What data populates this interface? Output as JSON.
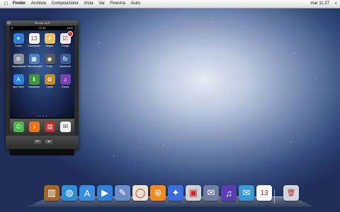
{
  "menubar": {
    "apple": "",
    "menus": [
      "Finder",
      "Archivio",
      "Composizione",
      "Vista",
      "Vai",
      "Finestra",
      "Aiuto"
    ],
    "clock": "mar 11.37"
  },
  "window": {
    "title": "iPhone 3GS",
    "status": {
      "carrier": "E",
      "time": "23.35",
      "battery": "61%"
    },
    "apps": [
      {
        "label": "Safari",
        "color": "#2c7fd6",
        "glyph": "✦"
      },
      {
        "label": "Calendario",
        "color": "#ffffff",
        "glyph": "13"
      },
      {
        "label": "Mappe",
        "color": "#e8c468",
        "glyph": "⌖"
      },
      {
        "label": "Things",
        "color": "#e9e9e9",
        "glyph": "☑",
        "badge": "3"
      },
      {
        "label": "Impostazioni",
        "color": "#8a8f99",
        "glyph": "⚙"
      },
      {
        "label": "WinterBoard",
        "color": "#4e7fc0",
        "glyph": "▦"
      },
      {
        "label": "Foto",
        "color": "#5a5a5a",
        "glyph": "◉"
      },
      {
        "label": "Facebook",
        "color": "#3b5b9a",
        "glyph": "fb"
      },
      {
        "label": "App Store",
        "color": "#2a7fe0",
        "glyph": "A"
      },
      {
        "label": "Installous",
        "color": "#3a9a3a",
        "glyph": "⬇"
      },
      {
        "label": "Cydia",
        "color": "#c98a2a",
        "glyph": "✿"
      },
      {
        "label": "iTunes",
        "color": "#7a3fb0",
        "glyph": "♫"
      }
    ],
    "page_dots": "• • • •",
    "dock_apps": [
      {
        "name": "phone",
        "color": "#4cb848",
        "glyph": "✆"
      },
      {
        "name": "music",
        "color": "#e8731c",
        "glyph": "♪"
      },
      {
        "name": "store",
        "color": "#b83232",
        "glyph": "▤"
      },
      {
        "name": "notes",
        "color": "#eeeeee",
        "glyph": "✉"
      }
    ],
    "buttons": [
      "↶",
      "▾"
    ]
  },
  "dock": [
    {
      "name": "bookshelf",
      "color": "#a0652a",
      "glyph": "▥"
    },
    {
      "name": "globe",
      "color": "#2f8fd6",
      "glyph": "◍"
    },
    {
      "name": "app-store",
      "color": "#3a8ee0",
      "glyph": "A"
    },
    {
      "name": "facetime",
      "color": "#2f7ed8",
      "glyph": "▶"
    },
    {
      "name": "preview",
      "color": "#6a8cc7",
      "glyph": "✎"
    },
    {
      "name": "egg",
      "color": "#e7e2d2",
      "glyph": "◯"
    },
    {
      "name": "rss",
      "color": "#f08a24",
      "glyph": "⊛"
    },
    {
      "name": "safari",
      "color": "#3a6ee0",
      "glyph": "✦"
    },
    {
      "name": "photo",
      "color": "#d0d0d0",
      "glyph": "▣"
    },
    {
      "name": "mail",
      "color": "#6e7fa0",
      "glyph": "✉"
    },
    {
      "name": "itunes",
      "color": "#5a3fb0",
      "glyph": "♫"
    },
    {
      "name": "chat",
      "color": "#3a9ad8",
      "glyph": "✉"
    },
    {
      "name": "calendar",
      "color": "#ffffff",
      "glyph": "13"
    },
    {
      "name": "trash",
      "color": "#cfd6e0",
      "glyph": "🗑"
    }
  ]
}
